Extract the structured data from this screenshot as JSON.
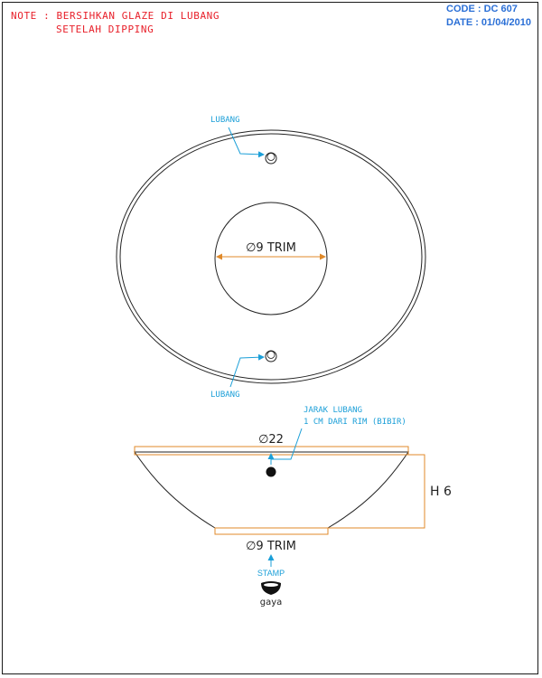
{
  "note": {
    "line1": "NOTE : BERSIHKAN GLAZE DI LUBANG",
    "line2": "SETELAH DIPPING"
  },
  "meta": {
    "code": "CODE : DC 607",
    "date": "DATE : 01/04/2010"
  },
  "top_view": {
    "hole_label_top": "LUBANG",
    "hole_label_bottom": "LUBANG",
    "trim_dim": "∅9 TRIM"
  },
  "side_view": {
    "hole_note_line1": "JARAK LUBANG",
    "hole_note_line2": "1 CM DARI RIM (BIBIR)",
    "diameter_dim": "∅22",
    "height_dim": "H 6",
    "base_dim": "∅9 TRIM",
    "stamp_label": "STAMP",
    "logo_text": "gaya"
  },
  "colors": {
    "note": "#e8202a",
    "meta": "#2a6fd6",
    "callout": "#1b9fd8",
    "dimension": "#e08a2a",
    "line": "#222222"
  }
}
